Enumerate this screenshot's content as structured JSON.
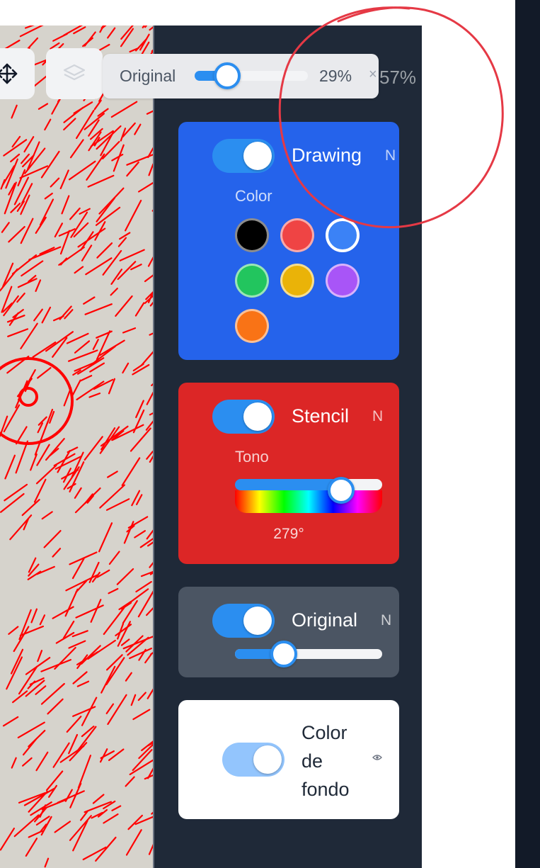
{
  "toolbar": {
    "move_icon": "move-arrows-icon",
    "layers_icon": "layers-icon",
    "opacity_label": "Original",
    "opacity_value": 29,
    "opacity_text": "29%",
    "ghost_close": "×",
    "ghost_percent": "57%"
  },
  "layers": {
    "drawing": {
      "title": "Drawing",
      "mode": "N",
      "enabled": true,
      "color_label": "Color",
      "colors": [
        {
          "name": "black",
          "hex": "#000000",
          "selected": false
        },
        {
          "name": "red",
          "hex": "#ef4444",
          "selected": false
        },
        {
          "name": "blue",
          "hex": "#3b82f6",
          "selected": true
        },
        {
          "name": "green",
          "hex": "#22c55e",
          "selected": false
        },
        {
          "name": "yellow",
          "hex": "#eab308",
          "selected": false
        },
        {
          "name": "purple",
          "hex": "#a855f7",
          "selected": false
        },
        {
          "name": "orange",
          "hex": "#f97316",
          "selected": false
        }
      ]
    },
    "stencil": {
      "title": "Stencil",
      "mode": "N",
      "enabled": true,
      "tone_label": "Tono",
      "hue_degrees": 279,
      "hue_text": "279°"
    },
    "original": {
      "title": "Original",
      "mode": "N",
      "enabled": true,
      "opacity_value": 33
    },
    "background": {
      "title": "Color de fondo",
      "enabled": true,
      "eye_icon": "eye-icon"
    }
  },
  "colors": {
    "panel_bg": "#1f2938",
    "accent": "#2b8ef0",
    "drawing_card": "#2563eb",
    "stencil_card": "#dc2626",
    "original_card": "#4b5563",
    "sketch_line": "#ff0000"
  }
}
